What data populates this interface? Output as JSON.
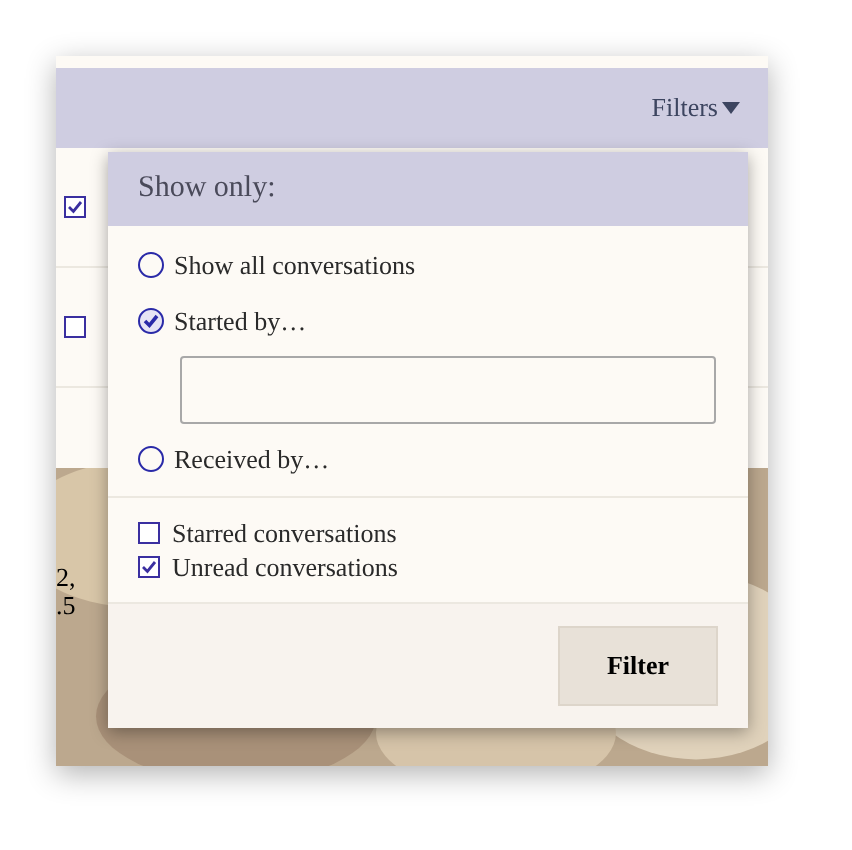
{
  "header": {
    "filters_button": "Filters"
  },
  "background_rows": [
    {
      "checked": true
    },
    {
      "checked": false
    }
  ],
  "background_text": [
    "2,",
    ".5"
  ],
  "popover": {
    "title": "Show only:",
    "radios": [
      {
        "label": "Show all conversations",
        "selected": false,
        "kind": "plain"
      },
      {
        "label": "Started by…",
        "selected": true,
        "kind": "with_field"
      },
      {
        "label": "Received by…",
        "selected": false,
        "kind": "plain"
      }
    ],
    "checkboxes": [
      {
        "label": "Starred conversations",
        "checked": false
      },
      {
        "label": "Unread conversations",
        "checked": true
      }
    ],
    "button": "Filter"
  }
}
